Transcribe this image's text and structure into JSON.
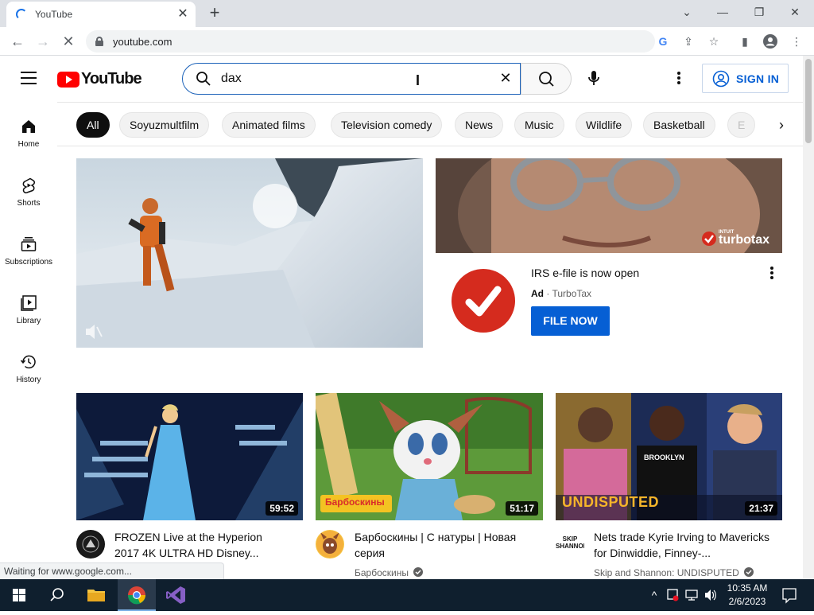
{
  "browser": {
    "tab_title": "YouTube",
    "url": "youtube.com",
    "status_text": "Waiting for www.google.com..."
  },
  "masthead": {
    "logo_text": "YouTube",
    "search_value": "dax",
    "sign_in_label": "SIGN IN"
  },
  "chips": [
    "All",
    "Soyuzmultfilm",
    "Animated films",
    "Television comedy",
    "News",
    "Music",
    "Wildlife",
    "Basketball",
    "E"
  ],
  "guide": [
    {
      "label": "Home",
      "icon": "home-icon"
    },
    {
      "label": "Shorts",
      "icon": "shorts-icon"
    },
    {
      "label": "Subscriptions",
      "icon": "subscriptions-icon"
    },
    {
      "label": "Library",
      "icon": "library-icon"
    },
    {
      "label": "History",
      "icon": "history-icon"
    }
  ],
  "ad": {
    "brand_logo_top": "INTUIT",
    "brand_logo": "turbotax",
    "title": "IRS e-file is now open",
    "ad_label": "Ad",
    "separator": "·",
    "advertiser": "TurboTax",
    "cta": "FILE NOW"
  },
  "videos": [
    {
      "title": "FROZEN Live at the Hyperion 2017 4K ULTRA HD Disney...",
      "channel": "",
      "duration": "59:52"
    },
    {
      "title": "Барбоскины | С натуры | Новая серия",
      "channel": "Барбоскины",
      "duration": "51:17",
      "thumb_text": "Барбоскины"
    },
    {
      "title": "Nets trade Kyrie Irving to Mavericks for Dinwiddie, Finney-...",
      "channel": "Skip and Shannon: UNDISPUTED",
      "duration": "21:37",
      "thumb_text": "UNDISPUTED",
      "avatar_text": "SKIP SHANNON"
    }
  ],
  "taskbar": {
    "time": "10:35 AM",
    "date": "2/6/2023"
  },
  "colors": {
    "youtube_red": "#ff0000",
    "link_blue": "#065fd4",
    "cta_blue": "#065fd4",
    "turbotax_red": "#d52b1e"
  }
}
